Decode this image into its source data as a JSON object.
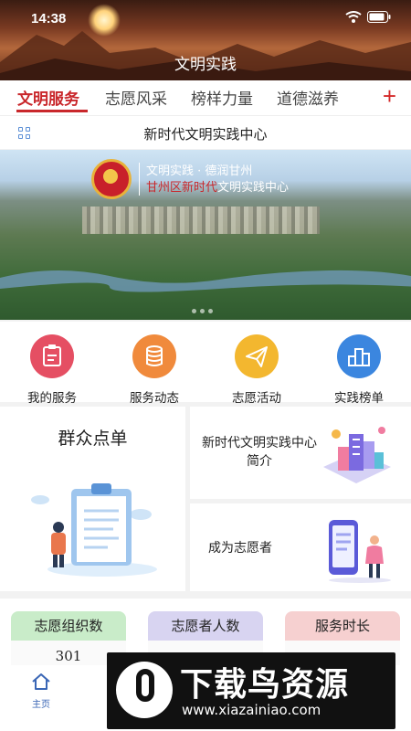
{
  "status_bar": {
    "time": "14:38"
  },
  "header": {
    "title": "文明实践"
  },
  "tabs": [
    {
      "label": "文明服务"
    },
    {
      "label": "志愿风采"
    },
    {
      "label": "榜样力量"
    },
    {
      "label": "道德滋养"
    }
  ],
  "tabs_add_label": "+",
  "subheader": {
    "title": "新时代文明实践中心"
  },
  "banner": {
    "line1": "文明实践 · 德润甘州",
    "line2_highlight": "甘州区新时代",
    "line2_rest": "文明实践中心"
  },
  "quick_actions": [
    {
      "label": "我的服务",
      "icon": "clipboard-icon",
      "color": "#e54f63"
    },
    {
      "label": "服务动态",
      "icon": "coins-icon",
      "color": "#f08a3c"
    },
    {
      "label": "志愿活动",
      "icon": "paper-plane-icon",
      "color": "#f3b72f"
    },
    {
      "label": "实践榜单",
      "icon": "podium-icon",
      "color": "#3b86df"
    }
  ],
  "cards": {
    "left_title": "群众点单",
    "right_top_title": "新时代文明实践中心简介",
    "right_bottom_title": "成为志愿者"
  },
  "stats": [
    {
      "label": "志愿组织数",
      "value": "301",
      "color": "#c9ecc9"
    },
    {
      "label": "志愿者人数",
      "value": "",
      "color": "#d8d4f1"
    },
    {
      "label": "服务时长",
      "value": "",
      "color": "#f6d0d0"
    }
  ],
  "bottom_nav": [
    {
      "label": "主页",
      "icon": "home-icon"
    }
  ],
  "watermark": {
    "title": "下载鸟资源",
    "url": "www.xiazainiao.com"
  }
}
